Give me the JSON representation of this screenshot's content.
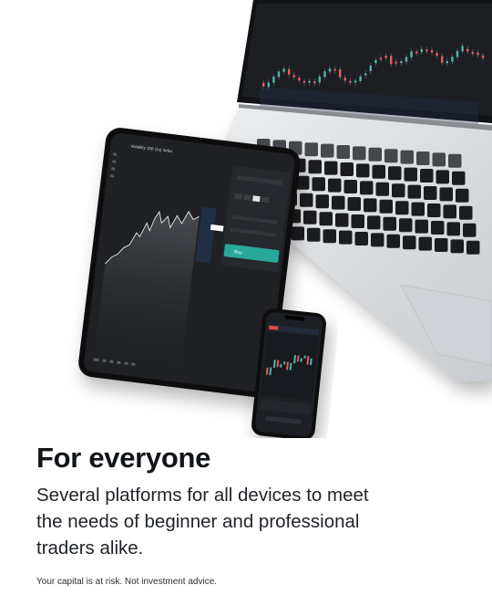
{
  "headline": "For everyone",
  "subtitle": "Several platforms for all devices to meet\nthe needs of beginner and professional\ntraders alike.",
  "disclaimer": "Your capital is at risk. Not investment advice.",
  "devices": [
    "laptop",
    "tablet",
    "phone"
  ],
  "tablet_screen": {
    "instrument": "Volatility 100 (1s) Index",
    "buy_label": "Buy"
  },
  "colors": {
    "accent_teal": "#2aa79b",
    "candle_up": "#4db6ac",
    "candle_down": "#e35d5d",
    "device_dark": "#1a1c1f",
    "laptop_silver": "#d8dadd"
  }
}
